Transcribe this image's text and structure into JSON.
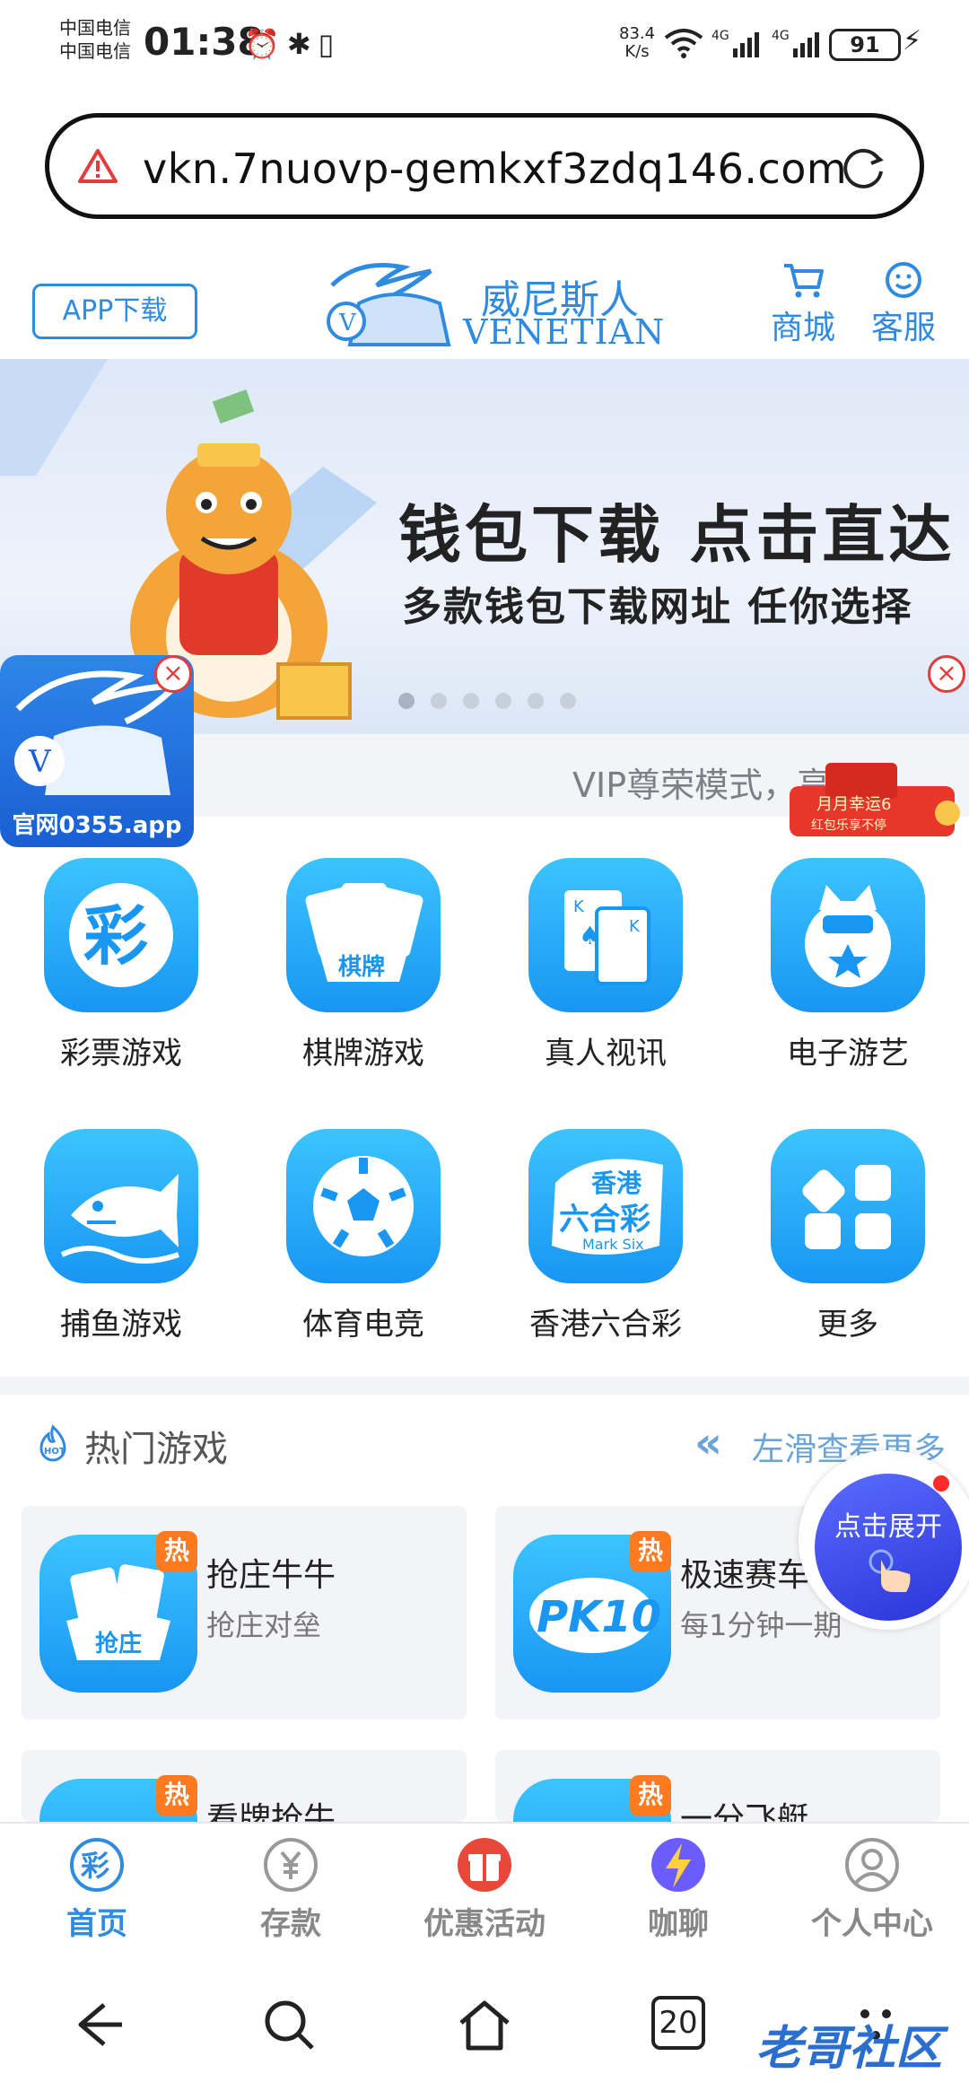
{
  "status_bar": {
    "carrier_1": "中国电信",
    "carrier_2": "中国电信",
    "time": "01:38",
    "net_speed_value": "83.4",
    "net_speed_unit": "K/s",
    "battery": "91"
  },
  "url_bar": {
    "url": "vkn.7nuovp-gemkxf3zdq146.com"
  },
  "header": {
    "app_download": "APP下载",
    "logo_cn": "威尼斯人",
    "logo_en": "VENETIAN",
    "shop_label": "商城",
    "service_label": "客服"
  },
  "banner": {
    "headline": "钱包下载  点击直达",
    "subline": "多款钱包下载网址  任你选择",
    "slide_count": 6
  },
  "promo": {
    "text": "官网0355.app"
  },
  "vip": {
    "text": "VIP尊荣模式，享…"
  },
  "red_pack": {
    "text_1": "月月幸运6",
    "text_2": "红包乐享不停"
  },
  "games": [
    {
      "label": "彩票游戏",
      "icon": "lottery-icon"
    },
    {
      "label": "棋牌游戏",
      "icon": "cards-icon"
    },
    {
      "label": "真人视讯",
      "icon": "live-casino-icon"
    },
    {
      "label": "电子游艺",
      "icon": "slots-icon"
    },
    {
      "label": "捕鱼游戏",
      "icon": "fish-icon"
    },
    {
      "label": "体育电竞",
      "icon": "soccer-icon"
    },
    {
      "label": "香港六合彩",
      "icon": "mark-six-icon"
    },
    {
      "label": "更多",
      "icon": "more-grid-icon"
    }
  ],
  "hot": {
    "title": "热门游戏",
    "more": "左滑查看更多",
    "badge": "热",
    "cards": [
      {
        "name": "抢庄牛牛",
        "desc": "抢庄对垒",
        "icon_text": "抢庄"
      },
      {
        "name": "极速赛车",
        "desc": "每1分钟一期",
        "icon_text": "PK10"
      },
      {
        "name": "看牌抢牛",
        "desc": "",
        "icon_text": ""
      },
      {
        "name": "一分飞艇",
        "desc": "",
        "icon_text": ""
      }
    ]
  },
  "expand": {
    "label": "点击展开"
  },
  "tabbar": [
    {
      "label": "首页",
      "active": true
    },
    {
      "label": "存款",
      "active": false
    },
    {
      "label": "优惠活动",
      "active": false
    },
    {
      "label": "咖聊",
      "active": false
    },
    {
      "label": "个人中心",
      "active": false
    }
  ],
  "system_nav": {
    "tabs_count": "20"
  },
  "watermark": "老哥社区",
  "colors": {
    "accent": "#2f8be0",
    "icon_gradient_top": "#3cc4ff",
    "icon_gradient_bottom": "#1896f2",
    "hot_badge": "#ff7a1f",
    "close_red": "#e23c3c"
  }
}
